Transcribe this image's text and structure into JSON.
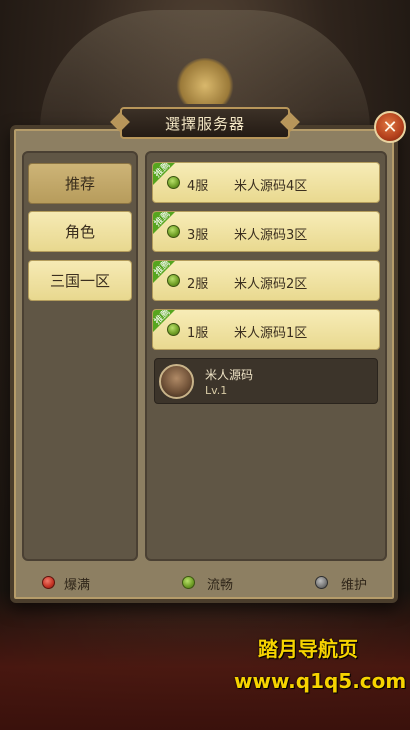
{
  "dialog": {
    "title": "選擇服务器",
    "close_label": "✕"
  },
  "tabs": [
    {
      "label": "推荐",
      "active": true
    },
    {
      "label": "角色",
      "active": false
    },
    {
      "label": "三国一区",
      "active": false
    }
  ],
  "servers": [
    {
      "badge": "推薦",
      "status": "green",
      "num": "4服",
      "name": "米人源码4区"
    },
    {
      "badge": "推薦",
      "status": "green",
      "num": "3服",
      "name": "米人源码3区"
    },
    {
      "badge": "推薦",
      "status": "green",
      "num": "2服",
      "name": "米人源码2区"
    },
    {
      "badge": "推薦",
      "status": "green",
      "num": "1服",
      "name": "米人源码1区"
    }
  ],
  "player": {
    "name": "米人源码",
    "level": "Lv.1"
  },
  "legend": [
    {
      "label": "爆满",
      "color": "#c43223"
    },
    {
      "label": "流畅",
      "color": "#6e9d25"
    },
    {
      "label": "维护",
      "color": "#777777"
    }
  ],
  "watermark": {
    "line1": "踏月导航页",
    "line2": "www.q1q5.com"
  },
  "colors": {
    "ribbon_green": "#56a51f",
    "panel": "#605645",
    "button_yellow": "#e9d990"
  }
}
